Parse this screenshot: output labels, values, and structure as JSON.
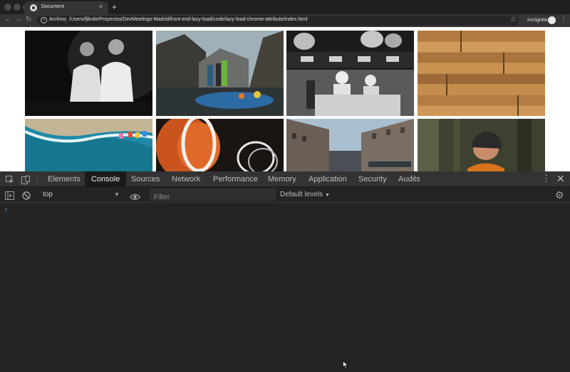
{
  "browser": {
    "tab_title": "Document",
    "tab_close": "×",
    "new_tab": "+",
    "back": "←",
    "forward": "→",
    "reload": "↻",
    "scheme_label": "Archivo",
    "url": "/Users/fjlinde/Proyectos/DevMeetings-Madrid/front-end-lazy-load/code/lazy-load-chrome-attribute/index.html",
    "star": "☆",
    "profile_label": "Incógnito",
    "menu": "⋮"
  },
  "devtools": {
    "tabs": [
      {
        "label": "Elements"
      },
      {
        "label": "Console"
      },
      {
        "label": "Sources"
      },
      {
        "label": "Network"
      },
      {
        "label": "Performance"
      },
      {
        "label": "Memory"
      },
      {
        "label": "Application"
      },
      {
        "label": "Security"
      },
      {
        "label": "Audits"
      }
    ],
    "active_tab": "Console",
    "menu": "⋮",
    "close": "✕"
  },
  "console": {
    "context": "top",
    "context_arrow": "▼",
    "filter_placeholder": "Filter",
    "levels_label": "Default levels",
    "levels_caret": "▼",
    "prompt": "›"
  },
  "gallery": {
    "photos": [
      {
        "subject": "two-men-black-and-white"
      },
      {
        "subject": "rafting-group-river-mountains"
      },
      {
        "subject": "chefs-kitchen-black-and-white"
      },
      {
        "subject": "wooden-planks"
      },
      {
        "subject": "aerial-beach-turquoise"
      },
      {
        "subject": "light-painting-orange"
      },
      {
        "subject": "city-street-buildings"
      },
      {
        "subject": "woman-beanie-forest"
      }
    ]
  },
  "colors": {
    "active_tab_bg": "#1a1a1a",
    "prompt_blue": "#4d9df0",
    "devtools_bg": "#242424"
  }
}
